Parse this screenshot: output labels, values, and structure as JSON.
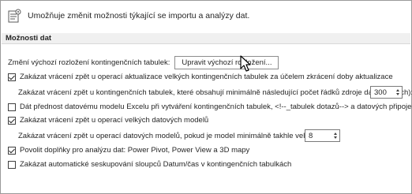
{
  "header": {
    "icon": "data-import-settings-icon",
    "text": "Umožňuje změnit možnosti týkající se importu a analýzy dat."
  },
  "section": {
    "title": "Možnosti dat"
  },
  "pivot_layout": {
    "label": "Změní výchozí rozložení kontingenčních tabulek:",
    "button_label": "Upravit výchozí rozložení..."
  },
  "options": [
    {
      "label": "Zakázat vrácení zpět u operací aktualizace velkých kontingenčních tabulek za účelem zkrácení doby aktualizace",
      "checked": true
    },
    {
      "label": "Zakázat vrácení zpět u kontingenčních tabulek, které obsahují minimálně následující počet řádků zdroje dat (v tisících):",
      "value": "300"
    },
    {
      "label": "Dát přednost datovému modelu Excelu při vytváření kontingenčních tabulek, <!--_tabulek dotazů--> a datových připojení",
      "checked": false
    },
    {
      "label": "Zakázat vrácení zpět u operací velkých datových modelů",
      "checked": true
    },
    {
      "label": "Zakázat vrácení zpět u operací datových modelů, pokud je model minimálně takhle velký (v MB):",
      "value": "8"
    },
    {
      "label": "Povolit doplňky pro analýzu dat: Power Pivot, Power View a 3D mapy",
      "checked": true
    },
    {
      "label": "Zakázat automatické seskupování sloupců Datum/čas v kontingenčních tabulkách",
      "checked": false
    }
  ],
  "info_glyph": "i"
}
